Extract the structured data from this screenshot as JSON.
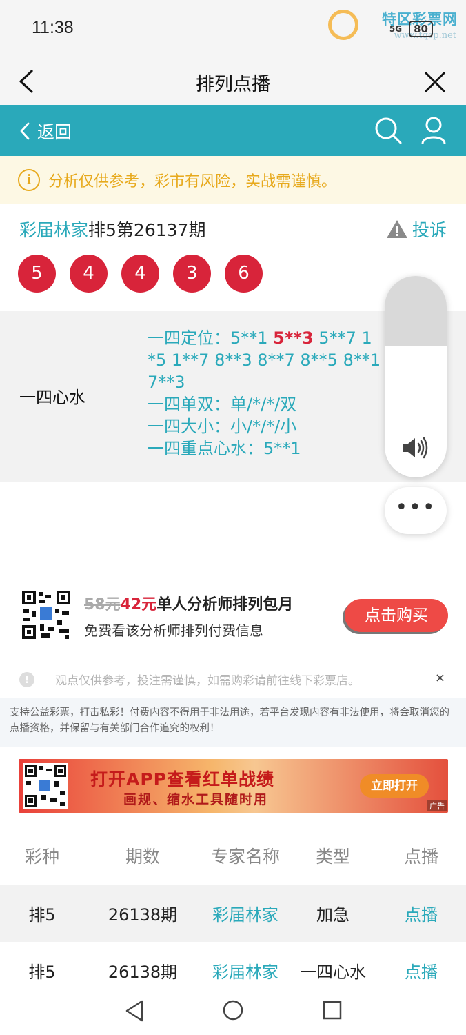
{
  "status": {
    "time": "11:38",
    "battery": "80",
    "network": "5G"
  },
  "watermark": {
    "text": "特区彩票网",
    "url": "www.tqcp.net"
  },
  "titlebar": {
    "title": "排列点播"
  },
  "nav": {
    "back_label": "返回"
  },
  "warning": {
    "text": "分析仅供参考，彩市有风险，实战需谨慎。"
  },
  "header": {
    "expert": "彩届林家",
    "period": "排5第26137期",
    "report_label": "投诉"
  },
  "balls": [
    "5",
    "4",
    "4",
    "3",
    "6"
  ],
  "prediction": {
    "type": "一四心水",
    "line1_prefix": "一四定位：5**1 ",
    "line1_highlight": "5**3",
    "line1_suffix": " 5**7 1",
    "line2": "*5 1**7 8**3 8**7 8**5 8**1",
    "line3": "7**3",
    "line4": "一四单双：单/*/*/双",
    "line5": "一四大小：小/*/*/小",
    "line6": "一四重点心水：5**1"
  },
  "more_label": "•••",
  "promo": {
    "old_price": "58元",
    "new_price": "42元",
    "title": "单人分析师排列包月",
    "subtitle": "免费看该分析师排列付费信息",
    "buy_label": "点击购买"
  },
  "notice": {
    "text": "观点仅供参考，投注需谨慎，如需购彩请前往线下彩票店。",
    "close": "×"
  },
  "disclaimer": {
    "text": "支持公益彩票，打击私彩！付费内容不得用于非法用途，若平台发现内容有非法使用，将会取消您的点播资格，并保留与有关部门合作追究的权利！"
  },
  "banner": {
    "main": "打开APP查看红单战绩",
    "sub": "画规、缩水工具随时用",
    "button": "立即打开",
    "ad_label": "广告"
  },
  "table": {
    "headers": [
      "彩种",
      "期数",
      "专家名称",
      "类型",
      "点播"
    ],
    "rows": [
      [
        "排5",
        "26138期",
        "彩届林家",
        "加急",
        "点播"
      ],
      [
        "排5",
        "26138期",
        "彩届林家",
        "一四心水",
        "点播"
      ]
    ]
  },
  "colors": {
    "teal": "#2aa9ba",
    "red": "#d8243a",
    "warn": "#e7a91c"
  }
}
